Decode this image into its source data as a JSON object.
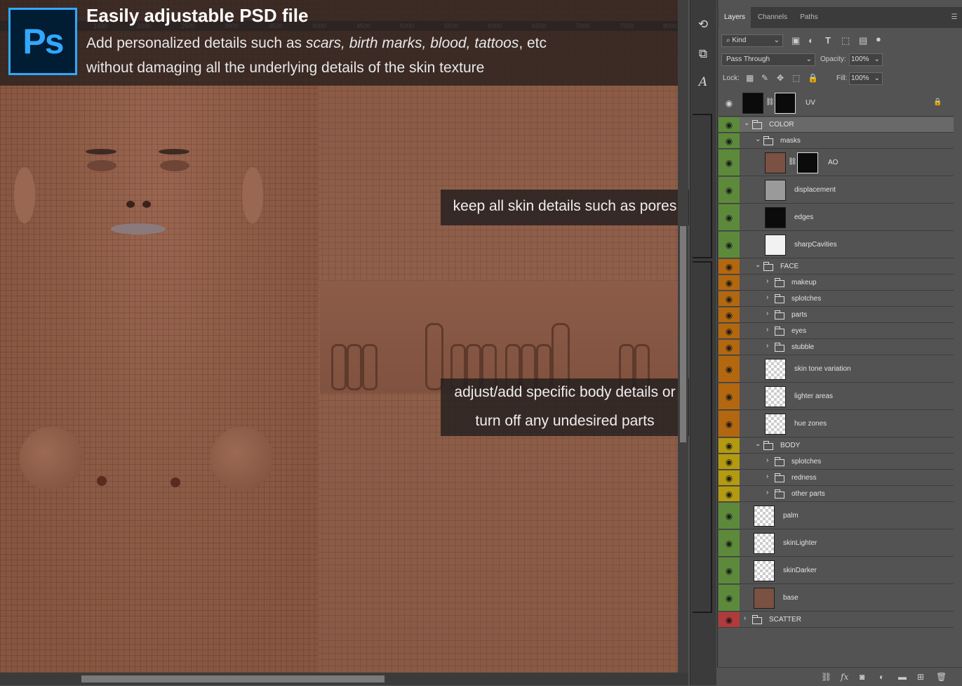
{
  "banner": {
    "logo": "Ps",
    "title": "Easily adjustable PSD file",
    "line1_prefix": "Add personalized details such as ",
    "line1_italic": "scars, birth marks, blood, tattoos",
    "line1_suffix": ", etc",
    "line2": "without damaging all the underlying details of the skin texture"
  },
  "ruler": [
    "1500",
    "2000",
    "2500",
    "3000",
    "3500",
    "4000",
    "4500",
    "5000",
    "5500",
    "6000",
    "6500",
    "7000",
    "7500",
    "8000"
  ],
  "callouts": {
    "pores": "keep all skin details such as pores",
    "body_line1": "adjust/add specific body details or",
    "body_line2": "turn off any undesired parts"
  },
  "panel": {
    "tabs": [
      "Layers",
      "Channels",
      "Paths"
    ],
    "kind_label": "Kind",
    "blend_mode": "Pass Through",
    "opacity_label": "Opacity:",
    "opacity_value": "100%",
    "lock_label": "Lock:",
    "fill_label": "Fill:",
    "fill_value": "100%"
  },
  "colors": {
    "green": "#5c8a3a",
    "orange": "#b3670f",
    "yellow": "#b39a0f",
    "red": "#b33a3a",
    "none": "#535353",
    "selected": "#696969"
  },
  "layers": [
    {
      "name": "UV",
      "type": "layer-mask",
      "tag": "none",
      "indent": 0,
      "locked": true
    },
    {
      "name": "COLOR",
      "type": "group",
      "tag": "green",
      "indent": 0,
      "open": true,
      "selected": true
    },
    {
      "name": "masks",
      "type": "group",
      "tag": "green",
      "indent": 1,
      "open": true
    },
    {
      "name": "AO",
      "type": "layer-mask",
      "tag": "green",
      "indent": 2
    },
    {
      "name": "displacement",
      "type": "layer",
      "tag": "green",
      "indent": 2,
      "thumb": "gray"
    },
    {
      "name": "edges",
      "type": "layer",
      "tag": "green",
      "indent": 2,
      "thumb": "black"
    },
    {
      "name": "sharpCavities",
      "type": "layer",
      "tag": "green",
      "indent": 2,
      "thumb": "white"
    },
    {
      "name": "FACE",
      "type": "group",
      "tag": "orange",
      "indent": 1,
      "open": true
    },
    {
      "name": "makeup",
      "type": "group",
      "tag": "orange",
      "indent": 2
    },
    {
      "name": "splotches",
      "type": "group",
      "tag": "orange",
      "indent": 2
    },
    {
      "name": "parts",
      "type": "group",
      "tag": "orange",
      "indent": 2
    },
    {
      "name": "eyes",
      "type": "group",
      "tag": "orange",
      "indent": 2
    },
    {
      "name": "stubble",
      "type": "group",
      "tag": "orange",
      "indent": 2
    },
    {
      "name": "skin tone variation",
      "type": "layer",
      "tag": "orange",
      "indent": 2,
      "thumb": "checker"
    },
    {
      "name": "lighter areas",
      "type": "layer",
      "tag": "orange",
      "indent": 2,
      "thumb": "checker"
    },
    {
      "name": "hue zones",
      "type": "layer",
      "tag": "orange",
      "indent": 2,
      "thumb": "checker"
    },
    {
      "name": "BODY",
      "type": "group",
      "tag": "yellow",
      "indent": 1,
      "open": true
    },
    {
      "name": "splotches",
      "type": "group",
      "tag": "yellow",
      "indent": 2
    },
    {
      "name": "redness",
      "type": "group",
      "tag": "yellow",
      "indent": 2
    },
    {
      "name": "other parts",
      "type": "group",
      "tag": "yellow",
      "indent": 2
    },
    {
      "name": "palm",
      "type": "layer",
      "tag": "green",
      "indent": 1,
      "thumb": "checker"
    },
    {
      "name": "skinLighter",
      "type": "layer",
      "tag": "green",
      "indent": 1,
      "thumb": "checker"
    },
    {
      "name": "skinDarker",
      "type": "layer",
      "tag": "green",
      "indent": 1,
      "thumb": "checker"
    },
    {
      "name": "base",
      "type": "layer",
      "tag": "green",
      "indent": 1,
      "thumb": "brown"
    },
    {
      "name": "SCATTER",
      "type": "group",
      "tag": "red",
      "indent": 0,
      "open": false
    }
  ]
}
